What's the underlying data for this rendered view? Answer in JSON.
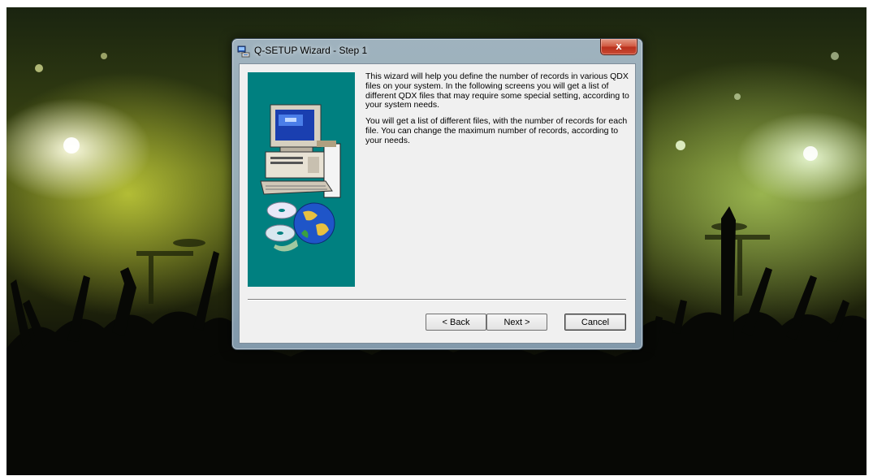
{
  "window": {
    "title": "Q-SETUP Wizard - Step 1",
    "close_label": "x"
  },
  "content": {
    "paragraph1": "This wizard will help you define the number of records in various QDX files on your system. In the following screens you will get a list of different QDX files that may require some special setting, according to your system needs.",
    "paragraph2": "You will get a list of different files, with the number of records for each file. You can change the maximum number of records, according to your needs."
  },
  "buttons": {
    "back": "< Back",
    "next": "Next >",
    "cancel": "Cancel"
  },
  "icons": {
    "app": "setup-app-icon",
    "side": "computer-and-globe-illustration"
  },
  "colors": {
    "side_panel": "#008080",
    "dialog_bg": "#f0f0f0",
    "close_button": "#c94a34"
  }
}
